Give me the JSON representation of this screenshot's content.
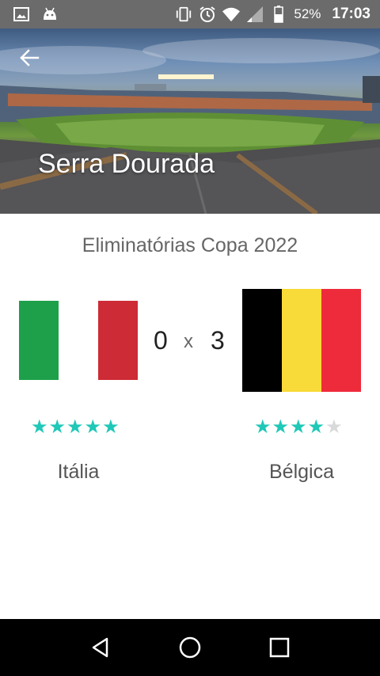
{
  "status_bar": {
    "battery": "52%",
    "time": "17:03",
    "icons": [
      "image-icon",
      "android-icon",
      "vibrate-icon",
      "alarm-icon",
      "wifi-icon",
      "signal-icon",
      "battery-icon"
    ]
  },
  "header": {
    "title": "Serra Dourada",
    "back_icon": "arrow-left-icon"
  },
  "match": {
    "competition": "Eliminatórias Copa 2022",
    "home": {
      "name": "Itália",
      "score": "0",
      "rating": 5,
      "rating_max": 5,
      "flag_colors": [
        "#1ea04a",
        "#ffffff",
        "#cd2b36"
      ]
    },
    "separator": "x",
    "away": {
      "name": "Bélgica",
      "score": "3",
      "rating": 4,
      "rating_max": 5,
      "flag_colors": [
        "#000000",
        "#f8da38",
        "#ee2b3b"
      ]
    }
  },
  "colors": {
    "star_on": "#1fc8b7",
    "star_off": "#d9d9d9",
    "status_bar": "#6b6b6b",
    "nav_bar": "#000000"
  },
  "nav_bar": {
    "icons": [
      "back-triangle-icon",
      "home-circle-icon",
      "recents-square-icon"
    ]
  }
}
